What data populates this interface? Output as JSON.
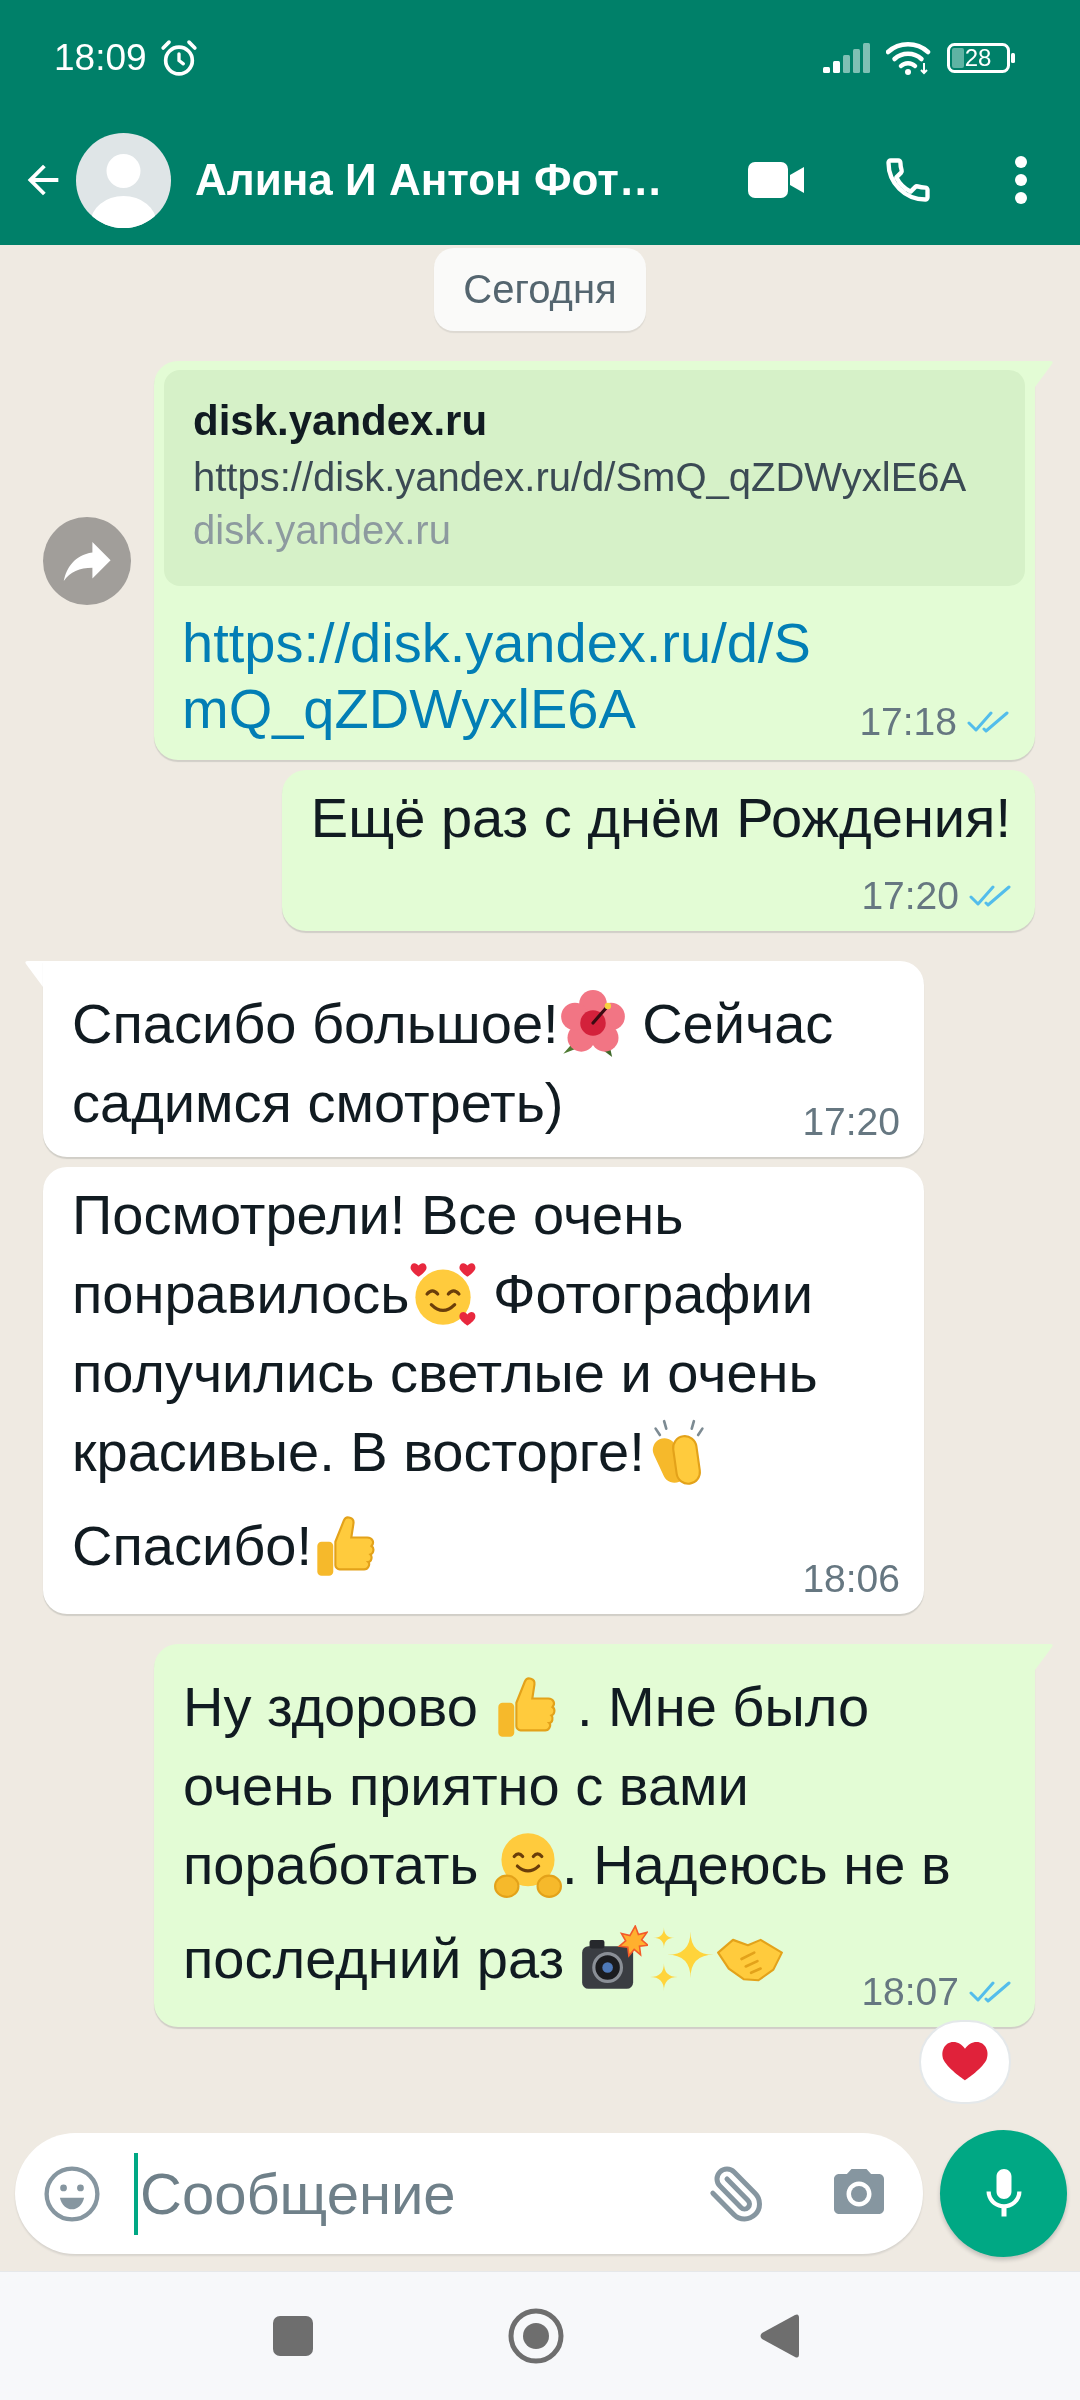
{
  "status_bar": {
    "time": "18:09",
    "battery": "28"
  },
  "chat_header": {
    "title": "Алина И Антон Фот…"
  },
  "date_divider": {
    "label": "Сегодня"
  },
  "messages": [
    {
      "kind": "outgoing",
      "forward": true,
      "read": true,
      "time": "17:18",
      "preview": {
        "title": "disk.yandex.ru",
        "url": "https://disk.yandex.ru/d/SmQ_qZDWyxlE6A",
        "domain": "disk.yandex.ru"
      },
      "link": "https://disk.yandex.ru/d/SmQ_qZDWyxlE6A"
    },
    {
      "kind": "outgoing",
      "forward": false,
      "read": true,
      "time": "17:20",
      "lines": [
        [
          {
            "kind": "text",
            "text": "Ещё раз с днём Рождения!"
          }
        ]
      ]
    },
    {
      "kind": "incoming",
      "forward": false,
      "time": "17:20",
      "lines": [
        [
          {
            "kind": "text",
            "text": "Спасибо большое!"
          },
          {
            "kind": "hibiscus"
          },
          {
            "kind": "text",
            "text": " Сейчас"
          }
        ],
        [
          {
            "kind": "text",
            "text": "садимся смотреть)"
          }
        ]
      ]
    },
    {
      "kind": "incoming",
      "forward": false,
      "time": "18:06",
      "lines": [
        [
          {
            "kind": "text",
            "text": "Посмотрели! Все очень"
          }
        ],
        [
          {
            "kind": "text",
            "text": "понравилось"
          },
          {
            "kind": "smiling-face-hearts"
          },
          {
            "kind": "text",
            "text": " Фотографии"
          }
        ],
        [
          {
            "kind": "text",
            "text": "получились светлые и очень"
          }
        ],
        [
          {
            "kind": "text",
            "text": "красивые. В восторге!"
          },
          {
            "kind": "clapping-hands"
          }
        ],
        [
          {
            "kind": "text",
            "text": "Спасибо!"
          },
          {
            "kind": "thumbs-up"
          }
        ]
      ]
    },
    {
      "kind": "outgoing",
      "forward": false,
      "read": true,
      "time": "18:07",
      "reaction": {
        "kind": "heart"
      },
      "lines": [
        [
          {
            "kind": "text",
            "text": "Ну здорово "
          },
          {
            "kind": "thumbs-up"
          },
          {
            "kind": "text",
            "text": " . Мне было"
          }
        ],
        [
          {
            "kind": "text",
            "text": "очень приятно с вами"
          }
        ],
        [
          {
            "kind": "text",
            "text": "поработать "
          },
          {
            "kind": "hugging-face"
          },
          {
            "kind": "text",
            "text": ". Надеюсь не в"
          }
        ],
        [
          {
            "kind": "text",
            "text": "последний раз "
          },
          {
            "kind": "camera-flash"
          },
          {
            "kind": "sparkles"
          },
          {
            "kind": "handshake"
          }
        ]
      ]
    }
  ],
  "composer": {
    "placeholder": "Сообщение"
  }
}
